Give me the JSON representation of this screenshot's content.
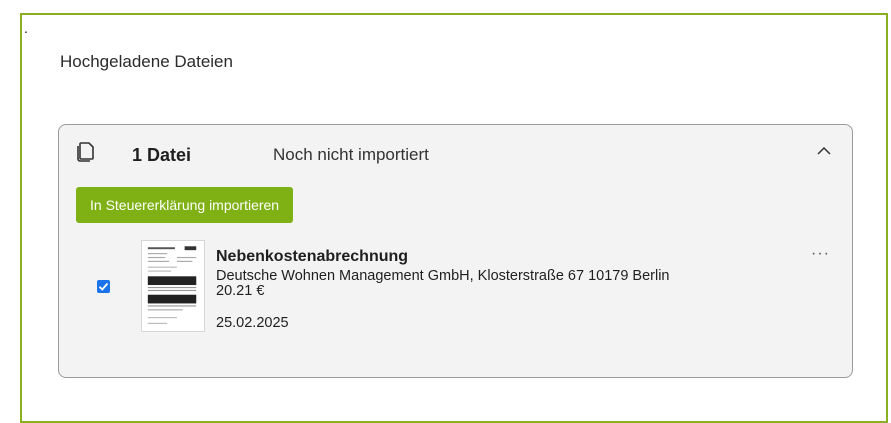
{
  "dot": ".",
  "section": {
    "title": "Hochgeladene Dateien"
  },
  "card": {
    "count_label": "1 Datei",
    "status_label": "Noch nicht importiert",
    "import_button_label": "In Steuererklärung importieren",
    "collapse_icon": "chevron-up-icon",
    "files_icon": "files-icon"
  },
  "document": {
    "checked": true,
    "title": "Nebenkostenabrechnung",
    "address": "Deutsche Wohnen Management GmbH, Klosterstraße 67 10179 Berlin",
    "amount": "20.21 €",
    "date": "25.02.2025",
    "more_icon": "more-horizontal-icon"
  },
  "colors": {
    "accent": "#7fb014",
    "frame": "#8ab021",
    "checkbox": "#1a73e8"
  }
}
